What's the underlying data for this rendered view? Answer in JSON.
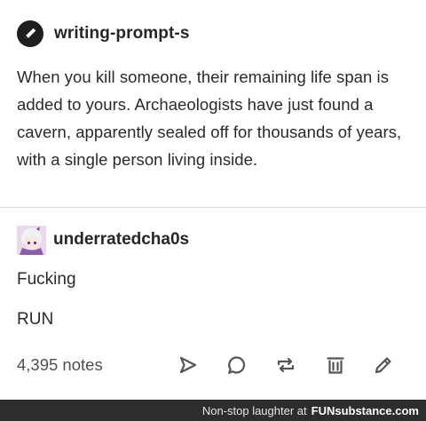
{
  "post": {
    "author": {
      "name": "writing-prompt-s",
      "avatar_icon": "pen-icon"
    },
    "text": "When you kill someone, their remaining life span is added to yours. Archaeologists have just found a cavern, apparently sealed off for thousands of years, with a single person living inside."
  },
  "reply": {
    "author": {
      "name": "underratedcha0s",
      "avatar_icon": "anime-character-avatar"
    },
    "lines": [
      "Fucking",
      "RUN"
    ]
  },
  "footer": {
    "notes": "4,395 notes",
    "actions": [
      "share-icon",
      "reply-icon",
      "reblog-icon",
      "delete-icon",
      "edit-icon"
    ]
  },
  "watermark": {
    "text": "Non-stop laughter at",
    "logo_fun": "FUN",
    "logo_substance": "substance.com"
  },
  "colors": {
    "text": "#2a2a2a",
    "divider": "#d9d9d9",
    "watermark_bg": "#2d2d2d"
  }
}
